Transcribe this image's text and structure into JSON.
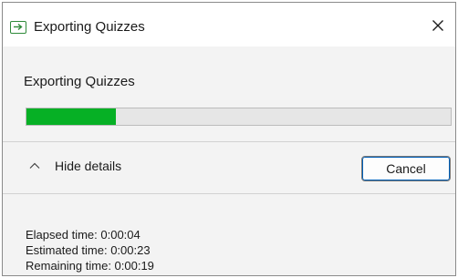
{
  "window": {
    "title": "Exporting Quizzes",
    "icon": "export-arrow-icon",
    "close_icon": "close-icon"
  },
  "main": {
    "heading": "Exporting Quizzes",
    "progress_fraction": 0.21,
    "progress_color": "#06b025"
  },
  "details": {
    "toggle_label": "Hide details",
    "toggle_icon": "chevron-up-icon",
    "cancel_label": "Cancel",
    "elapsed": "Elapsed time: 0:00:04",
    "estimated": "Estimated time: 0:00:23",
    "remaining": "Remaining time: 0:00:19"
  }
}
